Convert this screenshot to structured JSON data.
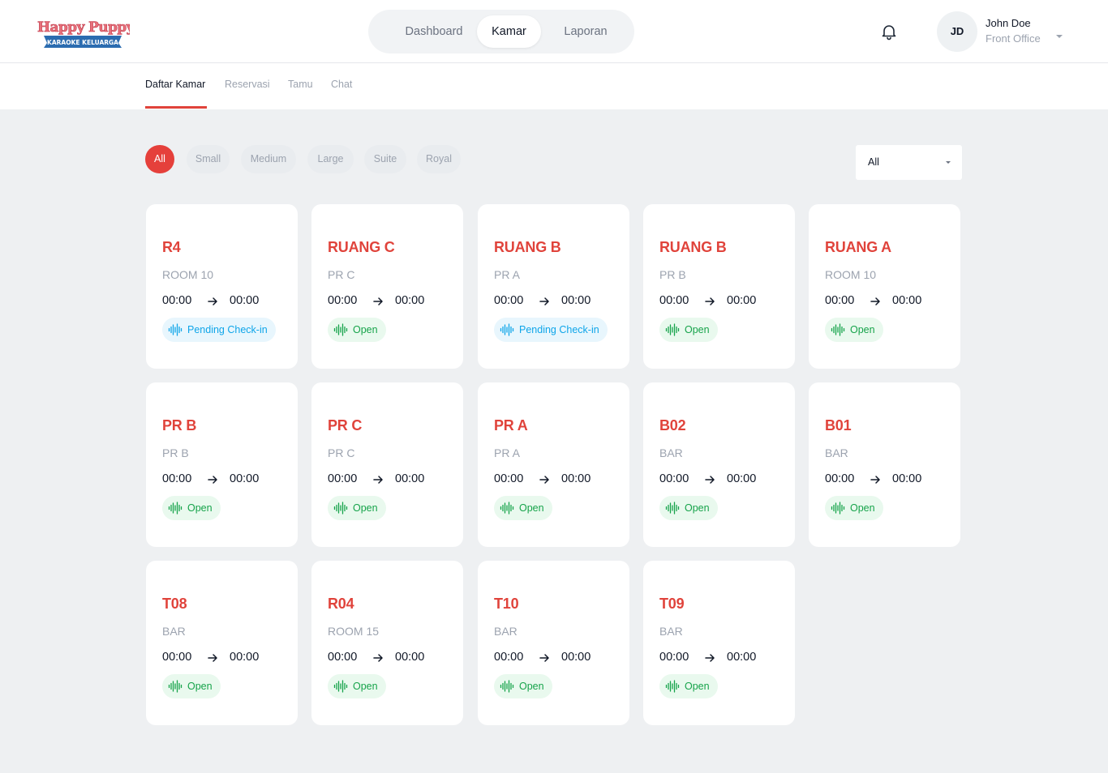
{
  "brand": {
    "logo_title": "Happy Puppy",
    "logo_subtitle": "KARAOKE KELUARGA"
  },
  "nav": {
    "items": [
      "Dashboard",
      "Kamar",
      "Laporan"
    ],
    "active": "Kamar"
  },
  "user": {
    "initials": "JD",
    "name": "John Doe",
    "role": "Front Office"
  },
  "subtabs": {
    "items": [
      "Daftar Kamar",
      "Reservasi",
      "Tamu",
      "Chat"
    ],
    "active": "Daftar Kamar"
  },
  "filters": {
    "chips": [
      "All",
      "Small",
      "Medium",
      "Large",
      "Suite",
      "Royal"
    ],
    "active": "All",
    "status_select": "All"
  },
  "colors": {
    "accent": "#e0433b",
    "open": "#16a34a",
    "pending": "#0ea5e9"
  },
  "rooms": [
    {
      "code": "R4",
      "type": "ROOM 10",
      "start": "00:00",
      "end": "00:00",
      "status": "Pending Check-in"
    },
    {
      "code": "RUANG C",
      "type": "PR C",
      "start": "00:00",
      "end": "00:00",
      "status": "Open"
    },
    {
      "code": "RUANG B",
      "type": "PR A",
      "start": "00:00",
      "end": "00:00",
      "status": "Pending Check-in"
    },
    {
      "code": "RUANG B",
      "type": "PR B",
      "start": "00:00",
      "end": "00:00",
      "status": "Open"
    },
    {
      "code": "RUANG A",
      "type": "ROOM 10",
      "start": "00:00",
      "end": "00:00",
      "status": "Open"
    },
    {
      "code": "PR B",
      "type": "PR B",
      "start": "00:00",
      "end": "00:00",
      "status": "Open"
    },
    {
      "code": "PR C",
      "type": "PR C",
      "start": "00:00",
      "end": "00:00",
      "status": "Open"
    },
    {
      "code": "PR A",
      "type": "PR A",
      "start": "00:00",
      "end": "00:00",
      "status": "Open"
    },
    {
      "code": "B02",
      "type": "BAR",
      "start": "00:00",
      "end": "00:00",
      "status": "Open"
    },
    {
      "code": "B01",
      "type": "BAR",
      "start": "00:00",
      "end": "00:00",
      "status": "Open"
    },
    {
      "code": "T08",
      "type": "BAR",
      "start": "00:00",
      "end": "00:00",
      "status": "Open"
    },
    {
      "code": "R04",
      "type": "ROOM 15",
      "start": "00:00",
      "end": "00:00",
      "status": "Open"
    },
    {
      "code": "T10",
      "type": "BAR",
      "start": "00:00",
      "end": "00:00",
      "status": "Open"
    },
    {
      "code": "T09",
      "type": "BAR",
      "start": "00:00",
      "end": "00:00",
      "status": "Open"
    }
  ]
}
